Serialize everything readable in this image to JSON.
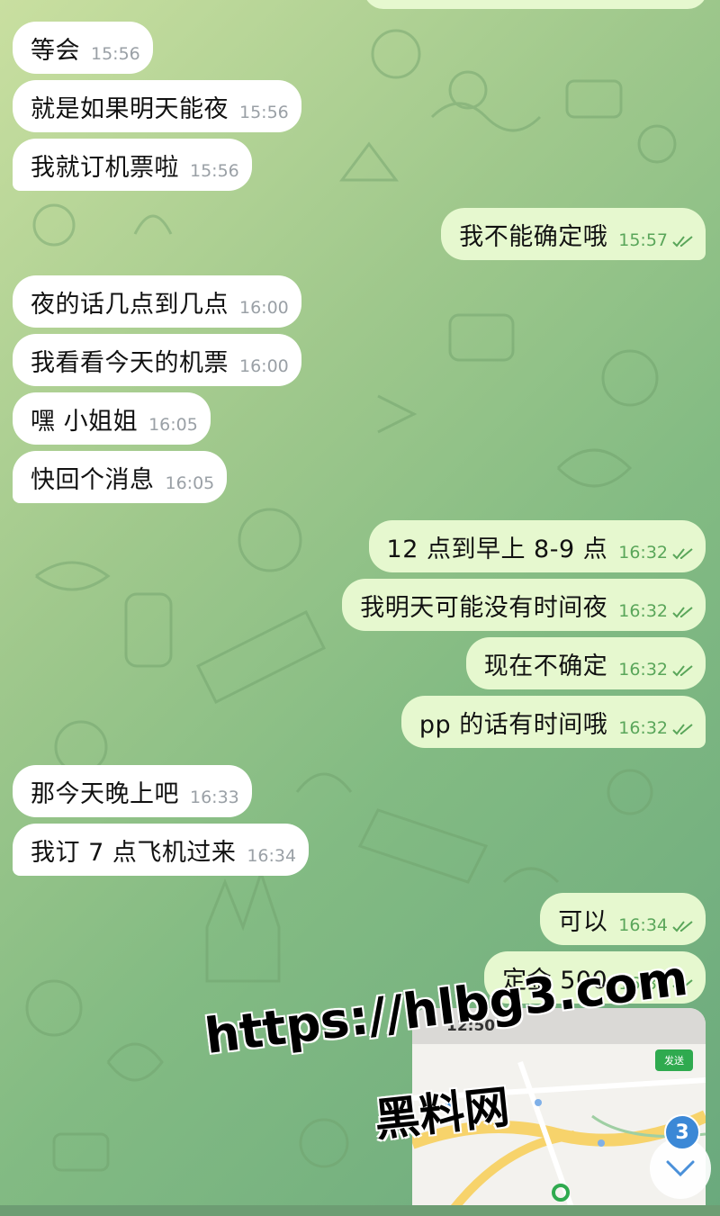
{
  "incoming_messages": [
    {
      "text": "等会",
      "time": "15:56"
    },
    {
      "text": "就是如果明天能夜",
      "time": "15:56"
    },
    {
      "text": "我就订机票啦",
      "time": "15:56"
    },
    {
      "text": "夜的话几点到几点",
      "time": "16:00"
    },
    {
      "text": "我看看今天的机票",
      "time": "16:00"
    },
    {
      "text": "嘿 小姐姐",
      "time": "16:05"
    },
    {
      "text": "快回个消息",
      "time": "16:05"
    },
    {
      "text": "那今天晚上吧",
      "time": "16:33"
    },
    {
      "text": "我订 7 点飞机过来",
      "time": "16:34"
    }
  ],
  "outgoing_messages": [
    {
      "text": "我不能确定哦",
      "time": "15:57"
    },
    {
      "text": "12 点到早上 8-9 点",
      "time": "16:32"
    },
    {
      "text": "我明天可能没有时间夜",
      "time": "16:32"
    },
    {
      "text": "现在不确定",
      "time": "16:32"
    },
    {
      "text": "pp 的话有时间哦",
      "time": "16:32"
    },
    {
      "text": "可以",
      "time": "16:34"
    },
    {
      "text": "定金 500",
      "time": "16:34"
    }
  ],
  "map_thumbnail": {
    "clock": "12:50",
    "send_label": "发送"
  },
  "watermark": {
    "url": "https://hlbg3.com",
    "name": "黑料网"
  },
  "scroll_badge": {
    "count": "3"
  },
  "colors": {
    "incoming_bubble": "#ffffff",
    "outgoing_bubble": "#e6f8cf",
    "outgoing_time": "#5aa65a",
    "badge": "#3b88d6"
  }
}
